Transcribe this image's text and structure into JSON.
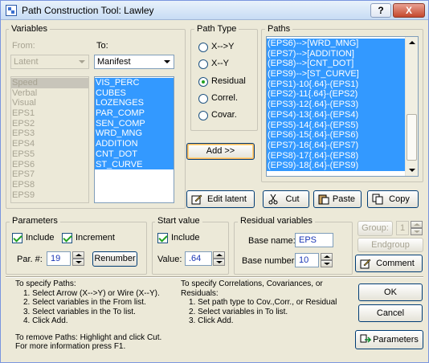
{
  "window": {
    "title": "Path Construction Tool: Lawley",
    "help_btn": "?",
    "close_btn": "X"
  },
  "variables": {
    "title": "Variables",
    "from_label": "From:",
    "to_label": "To:",
    "from_select": "Latent",
    "to_select": "Manifest",
    "from_list": [
      "Speed",
      "Verbal",
      "Visual",
      "EPS1",
      "EPS2",
      "EPS3",
      "EPS4",
      "EPS5",
      "EPS6",
      "EPS7",
      "EPS8",
      "EPS9"
    ],
    "to_list": [
      "VIS_PERC",
      "CUBES",
      "LOZENGES",
      "PAR_COMP",
      "SEN_COMP",
      "WRD_MNG",
      "ADDITION",
      "CNT_DOT",
      "ST_CURVE"
    ]
  },
  "path_type": {
    "title": "Path Type",
    "options": [
      "X-->Y",
      "X--Y",
      "Residual",
      "Correl.",
      "Covar."
    ],
    "selected": "Residual",
    "add_button": "Add >>",
    "edit_latent": "Edit latent"
  },
  "paths": {
    "title": "Paths",
    "items": [
      "(EPS6)-->[WRD_MNG]",
      "(EPS7)-->[ADDITION]",
      "(EPS8)-->[CNT_DOT]",
      "(EPS9)-->[ST_CURVE]",
      "(EPS1)-10{.64}-(EPS1)",
      "(EPS2)-11{.64}-(EPS2)",
      "(EPS3)-12{.64}-(EPS3)",
      "(EPS4)-13{.64}-(EPS4)",
      "(EPS5)-14{.64}-(EPS5)",
      "(EPS6)-15{.64}-(EPS6)",
      "(EPS7)-16{.64}-(EPS7)",
      "(EPS8)-17{.64}-(EPS8)",
      "(EPS9)-18{.64}-(EPS9)"
    ],
    "cut": "Cut",
    "paste": "Paste",
    "copy": "Copy"
  },
  "parameters": {
    "title": "Parameters",
    "include": "Include",
    "increment": "Increment",
    "par_label": "Par. #:",
    "par_value": "19",
    "renumber": "Renumber"
  },
  "start_value": {
    "title": "Start value",
    "include": "Include",
    "value_label": "Value:",
    "value": ".64"
  },
  "residual": {
    "title": "Residual variables",
    "base_name_label": "Base name:",
    "base_name": "EPS",
    "base_number_label": "Base number:",
    "base_number": "10"
  },
  "group": {
    "label": "Group:",
    "value": "1",
    "endgroup": "Endgroup",
    "comment": "Comment"
  },
  "help_left": {
    "title": "To specify Paths:",
    "steps": [
      "1. Select Arrow (X-->Y) or Wire (X--Y).",
      "2. Select variables in the From list.",
      "3. Select variables in the To list.",
      "4. Click Add."
    ],
    "remove": "To remove Paths: Highlight and click Cut.",
    "more": "For more information press F1."
  },
  "help_right": {
    "title1": "To specify Correlations, Covariances, or",
    "title2": "Residuals:",
    "steps": [
      "1. Set path type to Cov.,Corr., or Residual",
      "2. Select variables in To list.",
      "3. Click Add."
    ]
  },
  "buttons": {
    "ok": "OK",
    "cancel": "Cancel",
    "parameters": "Parameters"
  }
}
